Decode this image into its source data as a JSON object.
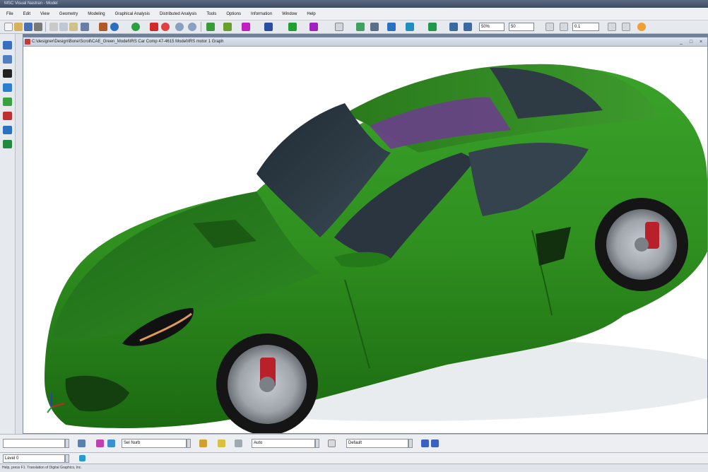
{
  "app": {
    "title": "MSC Visual Nastran - Model"
  },
  "menu": {
    "items": [
      {
        "label": "File"
      },
      {
        "label": "Edit"
      },
      {
        "label": "View"
      },
      {
        "label": "Geometry"
      },
      {
        "label": "Modeling"
      },
      {
        "label": "Graphical Analysis"
      },
      {
        "label": "Distributed Analysis"
      },
      {
        "label": "Tools"
      },
      {
        "label": "Options"
      },
      {
        "label": "Information"
      },
      {
        "label": "Window"
      },
      {
        "label": "Help"
      }
    ]
  },
  "toolbar": {
    "zoom_a": "50%",
    "zoom_b": "50",
    "step": "0.1"
  },
  "document": {
    "title": "C:\\designer\\Design\\Bone\\Scroll\\CAE_Green_Model\\IRS Car Comp 47-4615 Model\\IRS motor 1 Graph",
    "minimize": "_",
    "maximize": "□",
    "close": "×"
  },
  "option_bar": {
    "field1": "",
    "field2": "Sel Nurb",
    "field3": "Auto",
    "field4": "Default"
  },
  "command_line": {
    "value": "Level 0"
  },
  "status": {
    "text": "Help, press F1. Translation of Digital Graphics, Inc."
  },
  "colors": {
    "car_body": "#2f8f1f",
    "glass": "#2a3540",
    "sunroof": "#6a3f8a",
    "rim": "#9ea4aa",
    "caliper": "#b8202a",
    "background": "#ffffff"
  }
}
